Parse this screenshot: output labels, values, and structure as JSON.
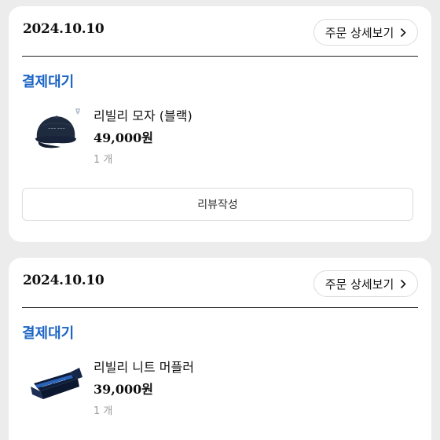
{
  "orders": [
    {
      "date": "2024.10.10",
      "detail_label": "주문 상세보기",
      "status": "결제대기",
      "product": {
        "name": "리빌리 모자 (블랙)",
        "price": "49,000원",
        "quantity": "1 개",
        "image_icon": "black-cap"
      },
      "review_label": "리뷰작성"
    },
    {
      "date": "2024.10.10",
      "detail_label": "주문 상세보기",
      "status": "결제대기",
      "product": {
        "name": "리빌리 니트 머플러",
        "price": "39,000원",
        "quantity": "1 개",
        "image_icon": "knit-muffler"
      }
    }
  ],
  "colors": {
    "status": "#1b64c4",
    "background": "#ececec",
    "card": "#ffffff"
  }
}
